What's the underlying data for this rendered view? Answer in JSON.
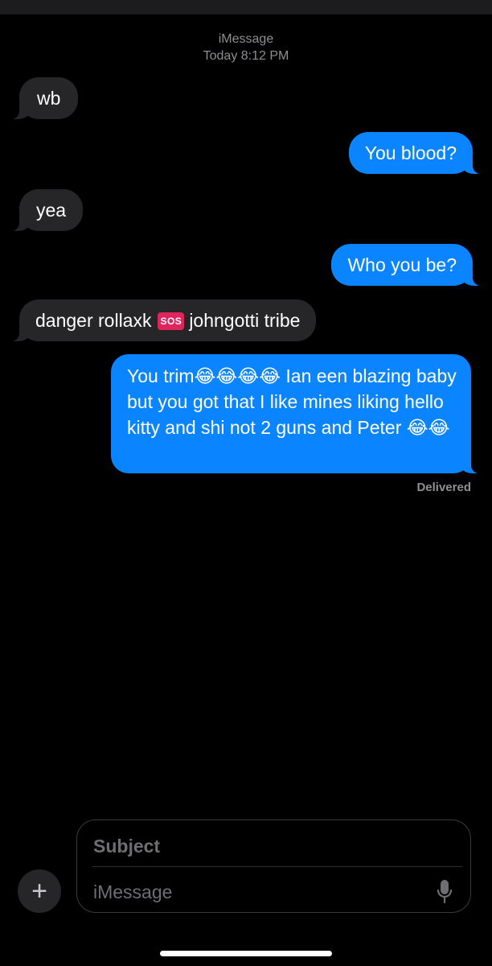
{
  "header": {
    "service": "iMessage",
    "day": "Today",
    "time": "8:12 PM"
  },
  "messages": [
    {
      "direction": "incoming",
      "text": "wb"
    },
    {
      "direction": "outgoing",
      "text": "You blood?"
    },
    {
      "direction": "incoming",
      "text": "yea"
    },
    {
      "direction": "outgoing",
      "text": "Who you be?"
    },
    {
      "direction": "incoming",
      "text_before": "danger rollaxk",
      "badge": "SOS",
      "text_after": "johngotti tribe"
    },
    {
      "direction": "outgoing",
      "text": "You trim😂😂😂😂 Ian een blazing baby but you got that I like mines liking hello kitty and shi not 2 guns and Peter 😂😂"
    }
  ],
  "status": "Delivered",
  "composer": {
    "subject_placeholder": "Subject",
    "message_placeholder": "iMessage",
    "add_icon": "plus-icon",
    "mic_icon": "microphone-icon"
  },
  "colors": {
    "outgoing_bubble": "#0a84ff",
    "incoming_bubble": "#262628",
    "background": "#000000",
    "secondary_text": "#8e8e93"
  }
}
